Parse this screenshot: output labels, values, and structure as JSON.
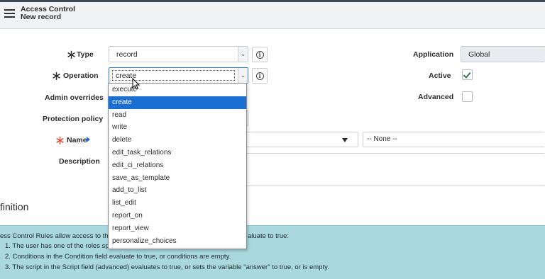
{
  "header": {
    "title": "Access Control",
    "subtitle": "New record"
  },
  "form": {
    "type_label": "Type",
    "type_value": "record",
    "operation_label": "Operation",
    "operation_value": "create",
    "admin_overrides_label": "Admin overrides",
    "protection_policy_label": "Protection policy",
    "name_label": "Name",
    "name_second_value": "-- None --",
    "description_label": "Description",
    "application_label": "Application",
    "application_value": "Global",
    "active_label": "Active",
    "active_checked": true,
    "advanced_label": "Advanced",
    "advanced_checked": false
  },
  "operation_options": [
    "execute",
    "create",
    "read",
    "write",
    "delete",
    "edit_task_relations",
    "edit_ci_relations",
    "save_as_template",
    "add_to_list",
    "list_edit",
    "report_on",
    "report_view",
    "personalize_choices"
  ],
  "selected_option": "create",
  "section": {
    "title": "finition",
    "line1": "ess Control Rules allow access to the s",
    "line1_tail": "aluate to true:",
    "line2": "1. The user has one of the roles spec",
    "line3": "2. Conditions in the Condition field evaluate to true, or conditions are empty.",
    "line4": "3. The script in the Script field (advanced) evaluates to true, or sets the variable \"answer\" to true, or is empty."
  },
  "colors": {
    "accent": "#1c6fd2",
    "required_star": "#e04d3a",
    "info_panel": "#a9d8de",
    "checkbox_check": "#2c7a4a"
  },
  "icons": {
    "menu": "hamburger-menu-icon",
    "info": "info-circle-icon",
    "chevron": "chevron-down-icon",
    "reference": "triangle-right-icon"
  }
}
